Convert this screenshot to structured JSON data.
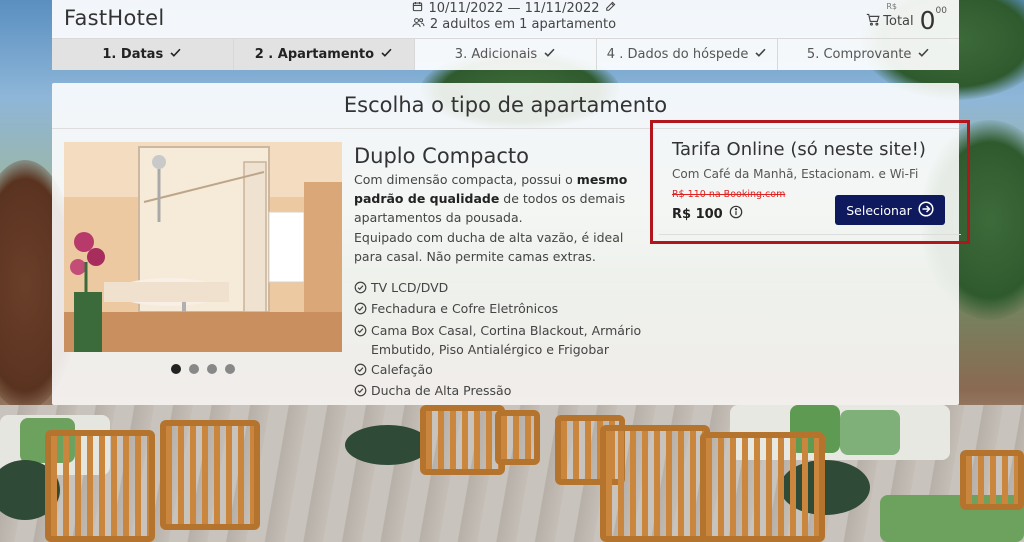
{
  "header": {
    "brand": "FastHotel",
    "dates": "10/11/2022 — 11/11/2022",
    "guests": "2 adultos em 1 apartamento",
    "cart_label": "Total",
    "currency": "R$",
    "total": "0",
    "total_cents": "00"
  },
  "steps": [
    {
      "label": "1. Datas",
      "done": true
    },
    {
      "label": "2 .  Apartamento",
      "done": true
    },
    {
      "label": "3. Adicionais",
      "done": false
    },
    {
      "label": "4 .  Dados do hóspede",
      "done": false
    },
    {
      "label": "5. Comprovante",
      "done": false
    }
  ],
  "main": {
    "title": "Escolha o tipo de apartamento",
    "room": {
      "name": "Duplo Compacto",
      "desc_1": "Com dimensão compacta, possui o ",
      "desc_bold": "mesmo padrão de qualidade",
      "desc_2": " de todos os demais apartamentos da pousada.",
      "desc_3": "Equipado com ducha de alta vazão, é ideal para casal. Não permite camas extras.",
      "amenities": [
        "TV LCD/DVD",
        "Fechadura e Cofre Eletrônicos",
        "Cama Box Casal, Cortina Blackout, Armário Embutido, Piso Antialérgico e Frigobar",
        "Calefação",
        "Ducha de Alta Pressão"
      ],
      "carousel_pages": 4,
      "carousel_active": 1
    },
    "rate": {
      "title": "Tarifa Online (só neste site!)",
      "subtitle": "Com Café da Manhã, Estacionam. e Wi-Fi",
      "strike": "R$ 110 na Booking.com",
      "price": "R$ 100",
      "button": "Selecionar"
    }
  },
  "colors": {
    "button_bg": "#0f1a5e",
    "highlight_border": "#b3151c",
    "strike_text": "#dd2222"
  },
  "icons": [
    "calendar-icon",
    "users-icon",
    "pencil-icon",
    "cart-icon",
    "check-icon",
    "circle-check-icon",
    "info-icon",
    "arrow-right-circle-icon"
  ]
}
